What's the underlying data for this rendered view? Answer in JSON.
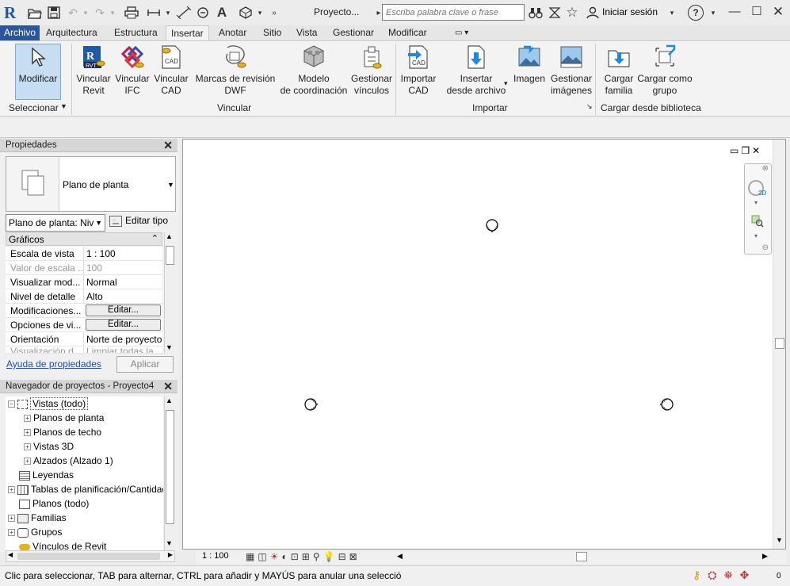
{
  "titlebar": {
    "app_logo": "R",
    "project_title": "Proyecto...",
    "search_placeholder": "Escriba palabra clave o frase",
    "signin_label": "Iniciar sesión",
    "help_label": "?"
  },
  "tabs": [
    {
      "label": "Archivo"
    },
    {
      "label": "Arquitectura"
    },
    {
      "label": "Estructura"
    },
    {
      "label": "Insertar"
    },
    {
      "label": "Anotar"
    },
    {
      "label": "Sitio"
    },
    {
      "label": "Vista"
    },
    {
      "label": "Gestionar"
    },
    {
      "label": "Modificar"
    }
  ],
  "ribbon": {
    "modify": {
      "label": "Modificar",
      "panel": "Seleccionar"
    },
    "link_revit": {
      "line1": "Vincular",
      "line2": "Revit"
    },
    "link_ifc": {
      "line1": "Vincular",
      "line2": "IFC"
    },
    "link_cad": {
      "line1": "Vincular",
      "line2": "CAD"
    },
    "dwf_markup": {
      "line1": "Marcas de revisión",
      "line2": "DWF"
    },
    "coord_model": {
      "line1": "Modelo",
      "line2": "de coordinación"
    },
    "manage_links": {
      "line1": "Gestionar",
      "line2": "vínculos"
    },
    "link_panel": "Vincular",
    "import_cad": {
      "line1": "Importar",
      "line2": "CAD"
    },
    "insert_from_file": {
      "line1": "Insertar",
      "line2": "desde archivo"
    },
    "image": {
      "line1": "Imagen"
    },
    "manage_images": {
      "line1": "Gestionar",
      "line2": "imágenes"
    },
    "import_panel": "Importar",
    "load_family": {
      "line1": "Cargar",
      "line2": "familia"
    },
    "load_group": {
      "line1": "Cargar como",
      "line2": "grupo"
    },
    "library_panel": "Cargar desde biblioteca",
    "cad_badge": "CAD",
    "rvt_badge": "RVT"
  },
  "properties": {
    "title": "Propiedades",
    "type_name": "Plano de planta",
    "family_selector": "Plano de planta: Niv",
    "edit_type": "Editar tipo",
    "group": "Gráficos",
    "rows": [
      {
        "key": "Escala de vista",
        "value": "1 : 100"
      },
      {
        "key": "Valor de escala ...",
        "value": "100"
      },
      {
        "key": "Visualizar mod...",
        "value": "Normal"
      },
      {
        "key": "Nivel de detalle",
        "value": "Alto"
      },
      {
        "key": "Modificaciones...",
        "value": "Editar..."
      },
      {
        "key": "Opciones de vi...",
        "value": "Editar..."
      },
      {
        "key": "Orientación",
        "value": "Norte de proyecto"
      },
      {
        "key": "Visualización d...",
        "value": "Limpiar todas la"
      }
    ],
    "help_link": "Ayuda de propiedades",
    "apply": "Aplicar"
  },
  "browser": {
    "title": "Navegador de proyectos - Proyecto4",
    "nodes": [
      {
        "label": "Vistas (todo)"
      },
      {
        "label": "Planos de planta"
      },
      {
        "label": "Planos de techo"
      },
      {
        "label": "Vistas 3D"
      },
      {
        "label": "Alzados (Alzado 1)"
      },
      {
        "label": "Leyendas"
      },
      {
        "label": "Tablas de planificación/Cantidades"
      },
      {
        "label": "Planos (todo)"
      },
      {
        "label": "Familias"
      },
      {
        "label": "Grupos"
      },
      {
        "label": "Vínculos de Revit"
      }
    ]
  },
  "viewctl": {
    "scale": "1 : 100"
  },
  "status": {
    "message": "Clic para seleccionar, TAB para alternar, CTRL para añadir y MAYÚS para anular una selecció",
    "filter_count": "0"
  },
  "navbar": {
    "label_2d": "2D"
  },
  "colors": {
    "accent": "#2b579a",
    "selected": "#c7ddf1",
    "link": "#1a4fc9"
  }
}
